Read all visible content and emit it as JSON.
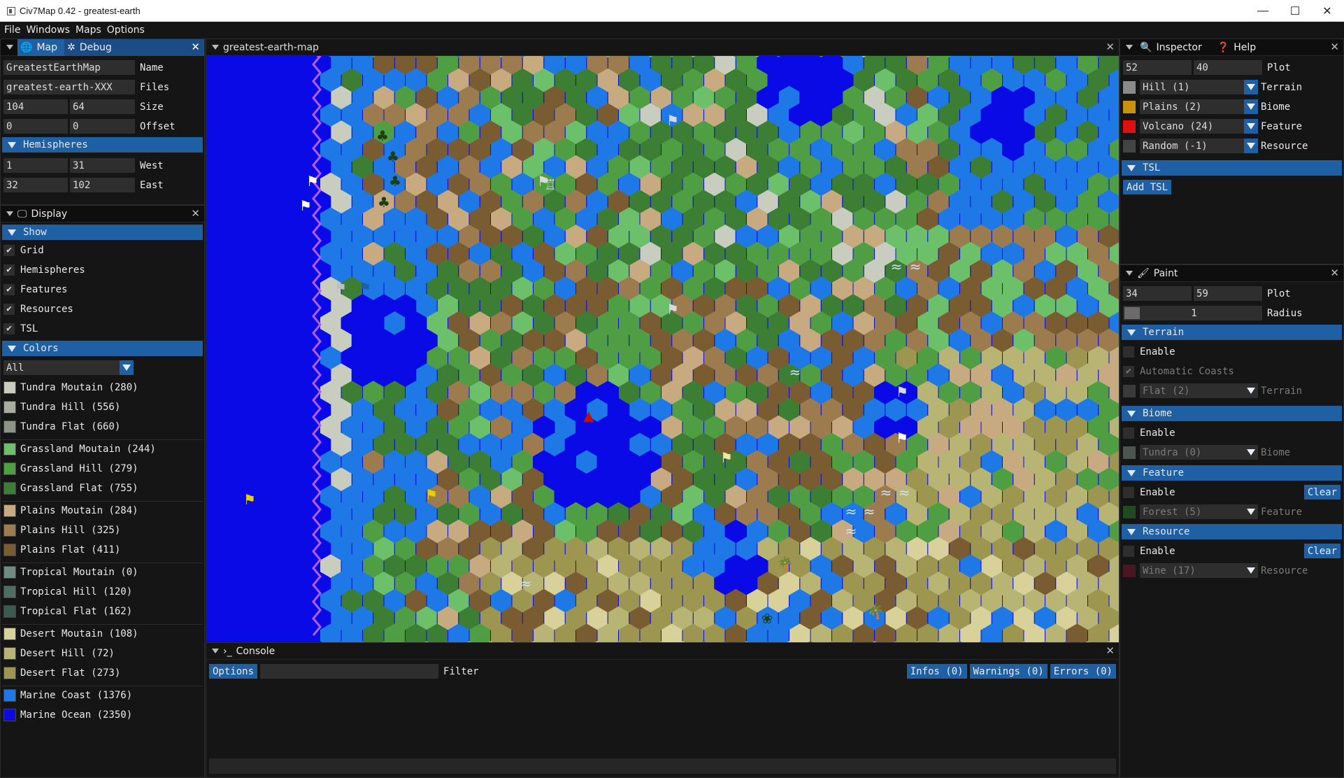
{
  "window": {
    "title": "Civ7Map 0.42 - greatest-earth",
    "minimize": "—",
    "maximize": "☐",
    "close": "✕"
  },
  "menu": [
    "File",
    "Windows",
    "Maps",
    "Options"
  ],
  "left_panel": {
    "tabs": [
      {
        "label": "Map",
        "icon": "globe-icon"
      },
      {
        "label": "Debug",
        "icon": "bug-icon"
      }
    ],
    "fields": [
      {
        "values": [
          "GreatestEarthMap"
        ],
        "label": "Name"
      },
      {
        "values": [
          "greatest-earth-XXX"
        ],
        "label": "Files"
      },
      {
        "values": [
          "104",
          "64"
        ],
        "label": "Size"
      },
      {
        "values": [
          "0",
          "0"
        ],
        "label": "Offset"
      }
    ],
    "hemispheres": {
      "title": "Hemispheres",
      "rows": [
        {
          "values": [
            "1",
            "31"
          ],
          "label": "West"
        },
        {
          "values": [
            "32",
            "102"
          ],
          "label": "East"
        }
      ]
    }
  },
  "display_panel": {
    "title": "Display",
    "show_title": "Show",
    "show_items": [
      "Grid",
      "Hemispheres",
      "Features",
      "Resources",
      "TSL"
    ],
    "colors_title": "Colors",
    "colors_filter": "All",
    "legend": [
      {
        "label": "Tundra Moutain (280)",
        "color": "#c9cdbf"
      },
      {
        "label": "Tundra Hill (556)",
        "color": "#a8ad9f"
      },
      {
        "label": "Tundra Flat (660)",
        "color": "#8d9387"
      },
      {
        "label": "Grassland Moutain (244)",
        "color": "#6cc06a"
      },
      {
        "label": "Grassland Hill (279)",
        "color": "#4f9e44"
      },
      {
        "label": "Grassland Flat (755)",
        "color": "#3c7e33"
      },
      {
        "label": "Plains Moutain (284)",
        "color": "#c8aa80"
      },
      {
        "label": "Plains Hill (325)",
        "color": "#9c7c4f"
      },
      {
        "label": "Plains Flat (411)",
        "color": "#7a5c33"
      },
      {
        "label": "Tropical Moutain (0)",
        "color": "#6e8c80"
      },
      {
        "label": "Tropical Hill (120)",
        "color": "#4f6e62"
      },
      {
        "label": "Tropical Flat (162)",
        "color": "#3c5a4e"
      },
      {
        "label": "Desert Moutain (108)",
        "color": "#d8d29a"
      },
      {
        "label": "Desert Hill (72)",
        "color": "#b8b474"
      },
      {
        "label": "Desert Flat (273)",
        "color": "#9c9650"
      },
      {
        "label": "Marine Coast (1376)",
        "color": "#1e78e6"
      },
      {
        "label": "Marine Ocean (2350)",
        "color": "#0a0ae6"
      }
    ]
  },
  "map_panel": {
    "title": "greatest-earth-map"
  },
  "console": {
    "title": "Console",
    "options": "Options",
    "filter_value": "",
    "filter_label": "Filter",
    "infos": "Infos (0)",
    "warnings": "Warnings (0)",
    "errors": "Errors (0)"
  },
  "inspector": {
    "tabs": [
      {
        "label": "Inspector",
        "icon": "search-icon"
      },
      {
        "label": "Help",
        "icon": "help-icon"
      }
    ],
    "plot": {
      "x": "52",
      "y": "40",
      "label": "Plot"
    },
    "rows": [
      {
        "value": "Hill (1)",
        "label": "Terrain",
        "color": "#8a8a8a"
      },
      {
        "value": "Plains (2)",
        "label": "Biome",
        "color": "#c8920e"
      },
      {
        "value": "Volcano (24)",
        "label": "Feature",
        "color": "#e01010"
      },
      {
        "value": "Random (-1)",
        "label": "Resource",
        "color": "#444444"
      }
    ],
    "tsl_title": "TSL",
    "add_tsl": "Add TSL"
  },
  "paint": {
    "title": "Paint",
    "plot": {
      "x": "34",
      "y": "59",
      "label": "Plot"
    },
    "radius": {
      "value": "1",
      "label": "Radius"
    },
    "terrain": {
      "title": "Terrain",
      "enable": "Enable",
      "auto": "Automatic Coasts",
      "value": "Flat (2)",
      "label": "Terrain"
    },
    "biome": {
      "title": "Biome",
      "enable": "Enable",
      "value": "Tundra (0)",
      "label": "Biome"
    },
    "feature": {
      "title": "Feature",
      "enable": "Enable",
      "clear": "Clear",
      "value": "Forest (5)",
      "label": "Feature"
    },
    "resource": {
      "title": "Resource",
      "enable": "Enable",
      "clear": "Clear",
      "value": "Wine (17)",
      "label": "Resource"
    }
  }
}
